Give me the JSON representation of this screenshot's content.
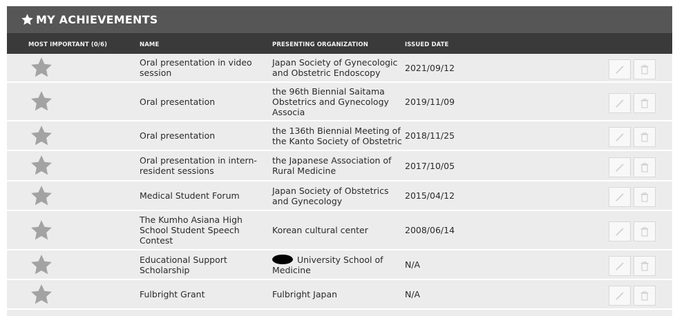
{
  "header": {
    "title": "MY ACHIEVEMENTS",
    "icon": "star-icon"
  },
  "columns": {
    "most_important": "MOST IMPORTANT (0/6)",
    "name": "NAME",
    "organization": "PRESENTING ORGANIZATION",
    "date": "ISSUED DATE"
  },
  "rows": [
    {
      "name": "Oral presentation in video session",
      "org": "Japan Society of Gynecologic and Obstetric Endoscopy",
      "date": "2021/09/12"
    },
    {
      "name": "Oral presentation",
      "org": "the 96th Biennial Saitama Obstetrics and Gynecology Associa",
      "date": "2019/11/09"
    },
    {
      "name": "Oral presentation",
      "org": "the 136th Biennial Meeting of the Kanto Society of Obstetric",
      "date": "2018/11/25"
    },
    {
      "name": "Oral presentation in intern-resident sessions",
      "org": "the Japanese Association of Rural Medicine",
      "date": "2017/10/05"
    },
    {
      "name": "Medical Student Forum",
      "org": "Japan Society of Obstetrics and Gynecology",
      "date": "2015/04/12"
    },
    {
      "name": "The Kumho Asiana High School Student Speech Contest",
      "org": "Korean cultural center",
      "date": "2008/06/14"
    },
    {
      "name": "Educational Support Scholarship",
      "org": " University School of Medicine",
      "date": "N/A",
      "org_redacted": true
    },
    {
      "name": "Fulbright Grant",
      "org": "Fulbright Japan",
      "date": "N/A"
    }
  ],
  "colors": {
    "header_bg": "#565656",
    "colhead_bg": "#3a3a3a",
    "row_bg": "#ececec",
    "star": "#a3a3a3"
  }
}
